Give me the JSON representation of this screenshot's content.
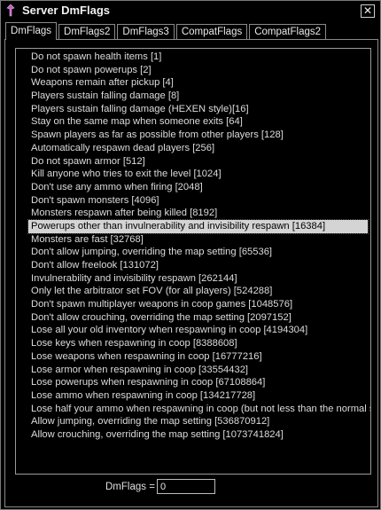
{
  "window": {
    "title": "Server DmFlags",
    "close_glyph": "✕"
  },
  "tabs": [
    {
      "label": "DmFlags",
      "active": true
    },
    {
      "label": "DmFlags2",
      "active": false
    },
    {
      "label": "DmFlags3",
      "active": false
    },
    {
      "label": "CompatFlags",
      "active": false
    },
    {
      "label": "CompatFlags2",
      "active": false
    }
  ],
  "flags": [
    "Do not spawn health items [1]",
    "Do not spawn powerups [2]",
    "Weapons remain after pickup [4]",
    "Players sustain falling damage [8]",
    "Players sustain falling damage (HEXEN style)[16]",
    "Stay on the same map when someone exits [64]",
    "Spawn players as far as possible from other players [128]",
    "Automatically respawn dead players [256]",
    "Do not spawn armor [512]",
    "Kill anyone who tries to exit the level [1024]",
    "Don't use any ammo when firing [2048]",
    "Don't spawn monsters [4096]",
    "Monsters respawn after being killed [8192]",
    "Powerups other than invulnerability and invisibility respawn [16384]",
    "Monsters are fast [32768]",
    "Don't allow jumping, overriding the map setting [65536]",
    "Don't allow freelook [131072]",
    "Invulnerability and invisibility respawn [262144]",
    "Only let the arbitrator set FOV (for all players) [524288]",
    "Don't spawn multiplayer weapons in coop games [1048576]",
    "Don't allow crouching, overriding the map setting [2097152]",
    "Lose all your old inventory when respawning in coop [4194304]",
    "Lose keys when respawning in coop [8388608]",
    "Lose weapons when respawning in coop [16777216]",
    "Lose armor when respawning in coop [33554432]",
    "Lose powerups when respawning in coop [67108864]",
    "Lose ammo when respawning in coop [134217728]",
    "Lose half your ammo when respawning in coop (but not less than the normal start",
    "Allow jumping, overriding the map setting [536870912]",
    "Allow crouching, overriding the map setting [1073741824]"
  ],
  "selected_index": 13,
  "footer": {
    "label": "DmFlags =",
    "value": "0"
  },
  "colors": {
    "background": "#000000",
    "text": "#e6e6e6",
    "selection": "#d4d4d4"
  }
}
